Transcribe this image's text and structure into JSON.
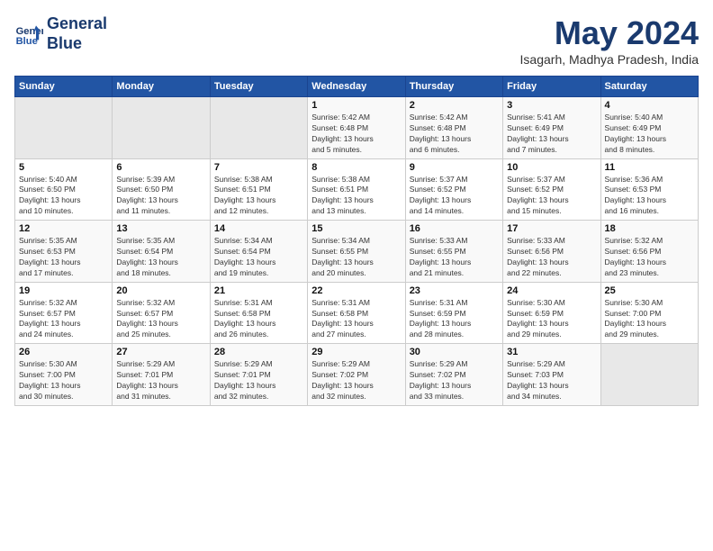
{
  "logo": {
    "line1": "General",
    "line2": "Blue"
  },
  "title": "May 2024",
  "location": "Isagarh, Madhya Pradesh, India",
  "weekdays": [
    "Sunday",
    "Monday",
    "Tuesday",
    "Wednesday",
    "Thursday",
    "Friday",
    "Saturday"
  ],
  "weeks": [
    [
      {
        "day": "",
        "info": ""
      },
      {
        "day": "",
        "info": ""
      },
      {
        "day": "",
        "info": ""
      },
      {
        "day": "1",
        "info": "Sunrise: 5:42 AM\nSunset: 6:48 PM\nDaylight: 13 hours\nand 5 minutes."
      },
      {
        "day": "2",
        "info": "Sunrise: 5:42 AM\nSunset: 6:48 PM\nDaylight: 13 hours\nand 6 minutes."
      },
      {
        "day": "3",
        "info": "Sunrise: 5:41 AM\nSunset: 6:49 PM\nDaylight: 13 hours\nand 7 minutes."
      },
      {
        "day": "4",
        "info": "Sunrise: 5:40 AM\nSunset: 6:49 PM\nDaylight: 13 hours\nand 8 minutes."
      }
    ],
    [
      {
        "day": "5",
        "info": "Sunrise: 5:40 AM\nSunset: 6:50 PM\nDaylight: 13 hours\nand 10 minutes."
      },
      {
        "day": "6",
        "info": "Sunrise: 5:39 AM\nSunset: 6:50 PM\nDaylight: 13 hours\nand 11 minutes."
      },
      {
        "day": "7",
        "info": "Sunrise: 5:38 AM\nSunset: 6:51 PM\nDaylight: 13 hours\nand 12 minutes."
      },
      {
        "day": "8",
        "info": "Sunrise: 5:38 AM\nSunset: 6:51 PM\nDaylight: 13 hours\nand 13 minutes."
      },
      {
        "day": "9",
        "info": "Sunrise: 5:37 AM\nSunset: 6:52 PM\nDaylight: 13 hours\nand 14 minutes."
      },
      {
        "day": "10",
        "info": "Sunrise: 5:37 AM\nSunset: 6:52 PM\nDaylight: 13 hours\nand 15 minutes."
      },
      {
        "day": "11",
        "info": "Sunrise: 5:36 AM\nSunset: 6:53 PM\nDaylight: 13 hours\nand 16 minutes."
      }
    ],
    [
      {
        "day": "12",
        "info": "Sunrise: 5:35 AM\nSunset: 6:53 PM\nDaylight: 13 hours\nand 17 minutes."
      },
      {
        "day": "13",
        "info": "Sunrise: 5:35 AM\nSunset: 6:54 PM\nDaylight: 13 hours\nand 18 minutes."
      },
      {
        "day": "14",
        "info": "Sunrise: 5:34 AM\nSunset: 6:54 PM\nDaylight: 13 hours\nand 19 minutes."
      },
      {
        "day": "15",
        "info": "Sunrise: 5:34 AM\nSunset: 6:55 PM\nDaylight: 13 hours\nand 20 minutes."
      },
      {
        "day": "16",
        "info": "Sunrise: 5:33 AM\nSunset: 6:55 PM\nDaylight: 13 hours\nand 21 minutes."
      },
      {
        "day": "17",
        "info": "Sunrise: 5:33 AM\nSunset: 6:56 PM\nDaylight: 13 hours\nand 22 minutes."
      },
      {
        "day": "18",
        "info": "Sunrise: 5:32 AM\nSunset: 6:56 PM\nDaylight: 13 hours\nand 23 minutes."
      }
    ],
    [
      {
        "day": "19",
        "info": "Sunrise: 5:32 AM\nSunset: 6:57 PM\nDaylight: 13 hours\nand 24 minutes."
      },
      {
        "day": "20",
        "info": "Sunrise: 5:32 AM\nSunset: 6:57 PM\nDaylight: 13 hours\nand 25 minutes."
      },
      {
        "day": "21",
        "info": "Sunrise: 5:31 AM\nSunset: 6:58 PM\nDaylight: 13 hours\nand 26 minutes."
      },
      {
        "day": "22",
        "info": "Sunrise: 5:31 AM\nSunset: 6:58 PM\nDaylight: 13 hours\nand 27 minutes."
      },
      {
        "day": "23",
        "info": "Sunrise: 5:31 AM\nSunset: 6:59 PM\nDaylight: 13 hours\nand 28 minutes."
      },
      {
        "day": "24",
        "info": "Sunrise: 5:30 AM\nSunset: 6:59 PM\nDaylight: 13 hours\nand 29 minutes."
      },
      {
        "day": "25",
        "info": "Sunrise: 5:30 AM\nSunset: 7:00 PM\nDaylight: 13 hours\nand 29 minutes."
      }
    ],
    [
      {
        "day": "26",
        "info": "Sunrise: 5:30 AM\nSunset: 7:00 PM\nDaylight: 13 hours\nand 30 minutes."
      },
      {
        "day": "27",
        "info": "Sunrise: 5:29 AM\nSunset: 7:01 PM\nDaylight: 13 hours\nand 31 minutes."
      },
      {
        "day": "28",
        "info": "Sunrise: 5:29 AM\nSunset: 7:01 PM\nDaylight: 13 hours\nand 32 minutes."
      },
      {
        "day": "29",
        "info": "Sunrise: 5:29 AM\nSunset: 7:02 PM\nDaylight: 13 hours\nand 32 minutes."
      },
      {
        "day": "30",
        "info": "Sunrise: 5:29 AM\nSunset: 7:02 PM\nDaylight: 13 hours\nand 33 minutes."
      },
      {
        "day": "31",
        "info": "Sunrise: 5:29 AM\nSunset: 7:03 PM\nDaylight: 13 hours\nand 34 minutes."
      },
      {
        "day": "",
        "info": ""
      }
    ]
  ]
}
